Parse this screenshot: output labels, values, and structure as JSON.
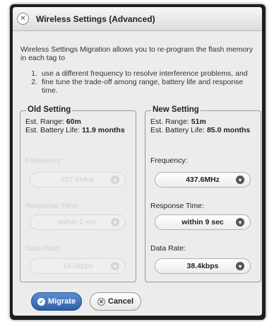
{
  "dialog": {
    "title": "Wireless Settings (Advanced)",
    "intro": "Wireless Settings Migration allows you to re-program the flash memory in each tag to",
    "steps": [
      {
        "num": "1.",
        "text": "use a different frequency to resolve interference problems, and"
      },
      {
        "num": "2.",
        "text": "fine tune the trade-off among range, battery life and response time."
      }
    ]
  },
  "old": {
    "legend": "Old Setting",
    "range_label": "Est. Range:",
    "range_value": "60m",
    "battery_label": "Est. Battery Life:",
    "battery_value": "11.9 months",
    "frequency_label": "Frequency:",
    "frequency_value": "437.6MHz",
    "response_label": "Response Time:",
    "response_value": "within 2 sec",
    "rate_label": "Data Rate:",
    "rate_value": "19.2kbps"
  },
  "new": {
    "legend": "New Setting",
    "range_label": "Est. Range:",
    "range_value": "51m",
    "battery_label": "Est. Battery Life:",
    "battery_value": "85.0 months",
    "frequency_label": "Frequency:",
    "frequency_value": "437.6MHz",
    "response_label": "Response Time:",
    "response_value": "within 9 sec",
    "rate_label": "Data Rate:",
    "rate_value": "38.4kbps"
  },
  "buttons": {
    "migrate": "Migrate",
    "cancel": "Cancel"
  },
  "icons": {
    "close": "close-icon",
    "check": "check-icon",
    "chevron": "chevron-down-icon"
  },
  "colors": {
    "accent": "#2d5fa8"
  }
}
